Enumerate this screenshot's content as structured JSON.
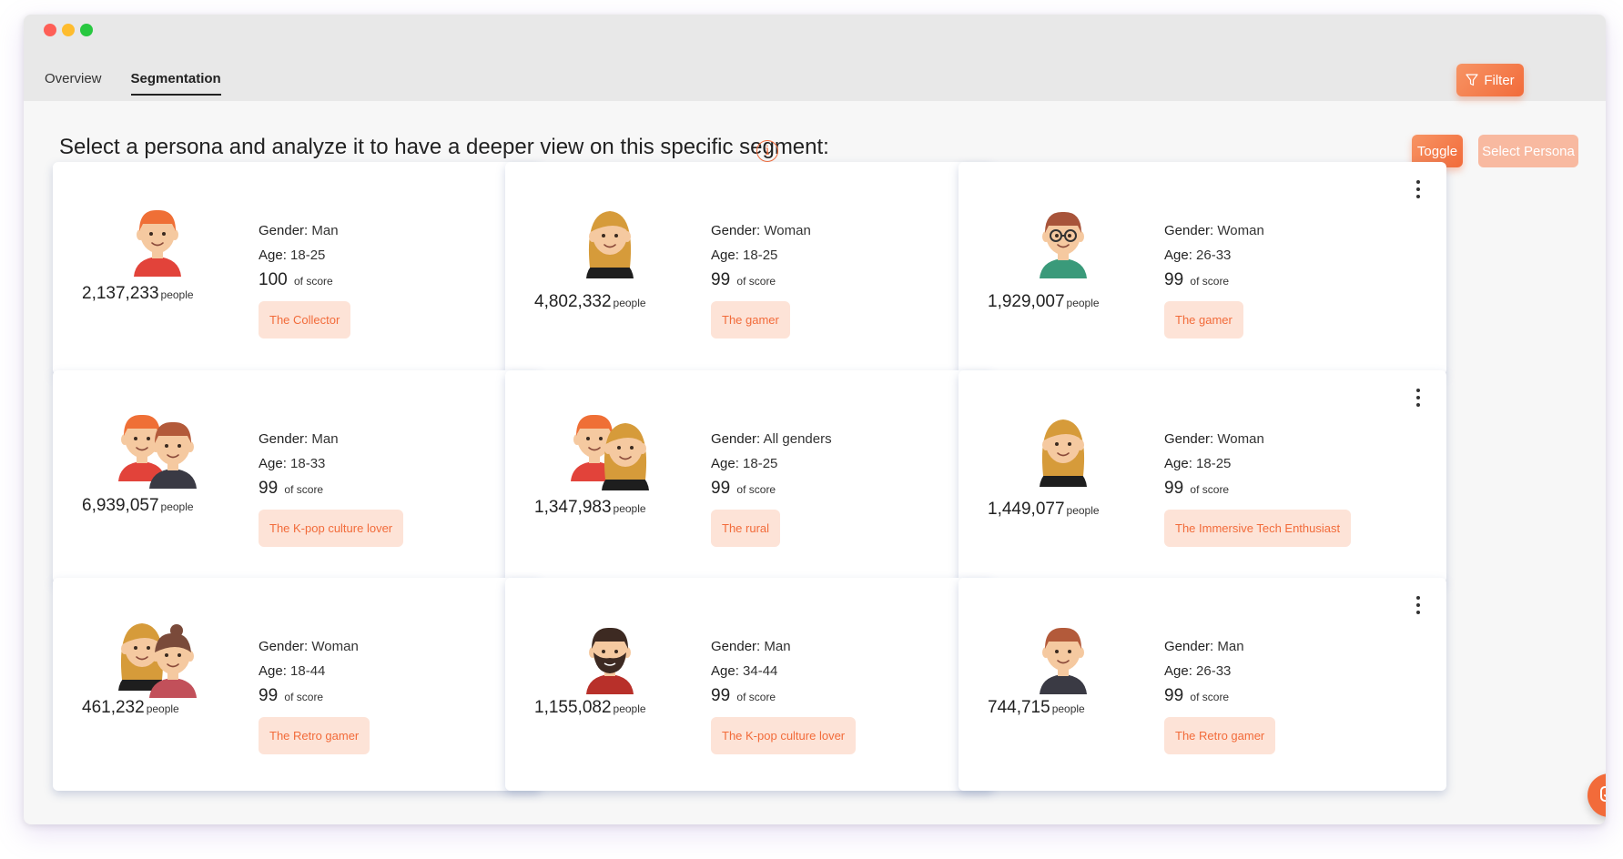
{
  "window": {
    "dot_colors": [
      "#fe5f57",
      "#febc2e",
      "#28c840"
    ]
  },
  "tabs": [
    {
      "label": "Overview",
      "active": false
    },
    {
      "label": "Segmentation",
      "active": true
    }
  ],
  "filter_button": {
    "label": "Filter",
    "icon": "funnel-icon"
  },
  "heading": "Select a persona and analyze it to have a deeper view on this specific segment:",
  "info_icon": "i",
  "toggle_button": "Toggle",
  "select_persona_button": "Select Persona",
  "labels": {
    "gender": "Gender:",
    "age": "Age:",
    "score_suffix": "of score",
    "people": "people"
  },
  "personas": [
    {
      "count": "2,137,233",
      "gender": "Man",
      "age": "18-25",
      "score": "100",
      "tag": "The Collector",
      "avatar": "man-red-hair"
    },
    {
      "count": "4,802,332",
      "gender": "Woman",
      "age": "18-25",
      "score": "99",
      "tag": "The gamer",
      "avatar": "woman-long-hair"
    },
    {
      "count": "1,929,007",
      "gender": "Woman",
      "age": "26-33",
      "score": "99",
      "tag": "The gamer",
      "avatar": "woman-glasses"
    },
    {
      "count": "6,939,057",
      "gender": "Man",
      "age": "18-33",
      "score": "99",
      "tag": "The K-pop culture lover",
      "avatar": "two-men"
    },
    {
      "count": "1,347,983",
      "gender": "All genders",
      "age": "18-25",
      "score": "99",
      "tag": "The rural",
      "avatar": "man-and-woman"
    },
    {
      "count": "1,449,077",
      "gender": "Woman",
      "age": "18-25",
      "score": "99",
      "tag": "The Immersive Tech Enthusiast",
      "avatar": "woman-long-hair"
    },
    {
      "count": "461,232",
      "gender": "Woman",
      "age": "18-44",
      "score": "99",
      "tag": "The Retro gamer",
      "avatar": "two-women"
    },
    {
      "count": "1,155,082",
      "gender": "Man",
      "age": "34-44",
      "score": "99",
      "tag": "The K-pop culture lover",
      "avatar": "man-beard"
    },
    {
      "count": "744,715",
      "gender": "Man",
      "age": "26-33",
      "score": "99",
      "tag": "The Retro gamer",
      "avatar": "man-brown-hair"
    }
  ],
  "chat_button": {
    "icon": "chat-icon"
  }
}
